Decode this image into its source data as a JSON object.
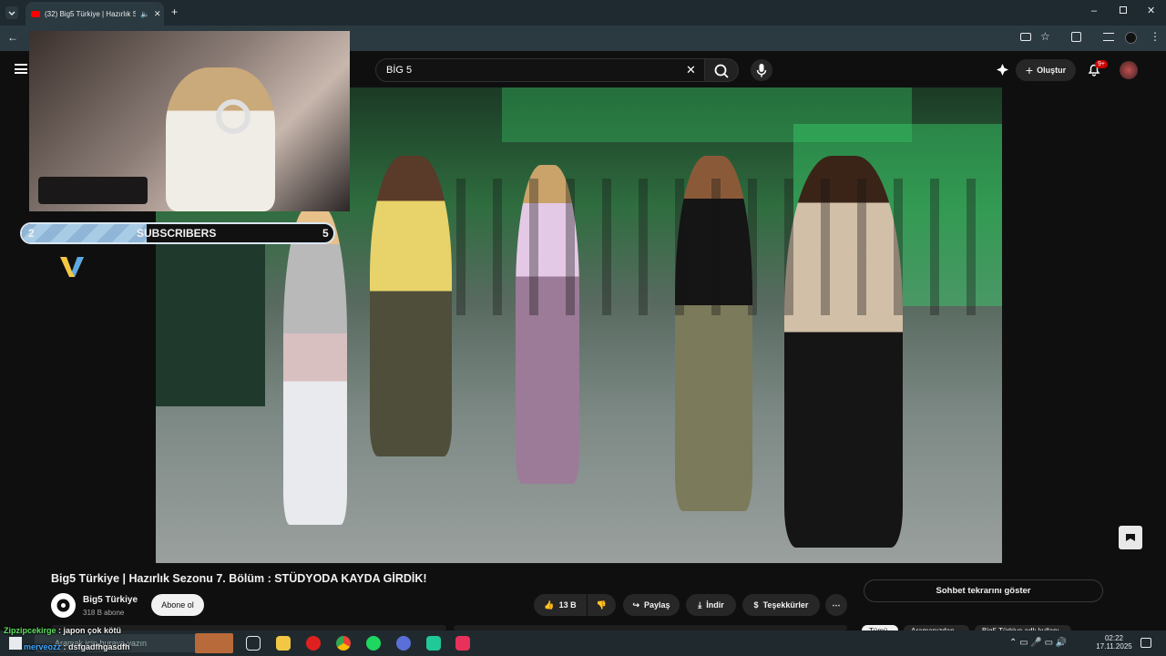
{
  "browser": {
    "tab_title": "(32) Big5 Türkiye | Hazırlık S",
    "icons": [
      "tab-list-icon",
      "youtube-favicon",
      "mute-icon",
      "close-icon",
      "new-tab-icon",
      "minimize-icon",
      "restore-icon",
      "back-icon",
      "cast-icon",
      "star-icon",
      "extensions-icon",
      "media-icon",
      "profile-icon",
      "menu-icon"
    ]
  },
  "youtube": {
    "search_value": "BİG 5",
    "create_label": "Oluştur",
    "notif_badge": "9+"
  },
  "overlay": {
    "subs_current": "2",
    "subs_label": "SUBSCRIBERS",
    "subs_goal": "5",
    "progress_fraction": 0.4
  },
  "video_info": {
    "title": "Big5 Türkiye | Hazırlık Sezonu 7. Bölüm : STÜDYODA KAYDA GİRDİK!",
    "channel_name": "Big5 Türkiye",
    "subscriber_count": "318 B abone",
    "subscribe_label": "Abone ol",
    "like_count": "13 B",
    "share_label": "Paylaş",
    "download_label": "İndir",
    "thanks_label": "Teşekkürler",
    "chat_replay_label": "Sohbet tekrarını göster",
    "chips": [
      "Tümü",
      "Aramanızdan",
      "Big5 Türkiye adlı kullanı"
    ]
  },
  "chat": [
    {
      "user": "Zipzipcekirge",
      "text": "japon çok kötü"
    },
    {
      "user": "merveozz",
      "text": "dsfgadfhgasdfh"
    }
  ],
  "taskbar": {
    "search_placeholder": "Aramak için buraya yazın",
    "time": "02:22",
    "date": "17.11.2025"
  },
  "colors": {
    "accent_red": "#ff0000",
    "chat_user_green": "#5ee05e",
    "chat_user_blue": "#3ea6ff"
  }
}
